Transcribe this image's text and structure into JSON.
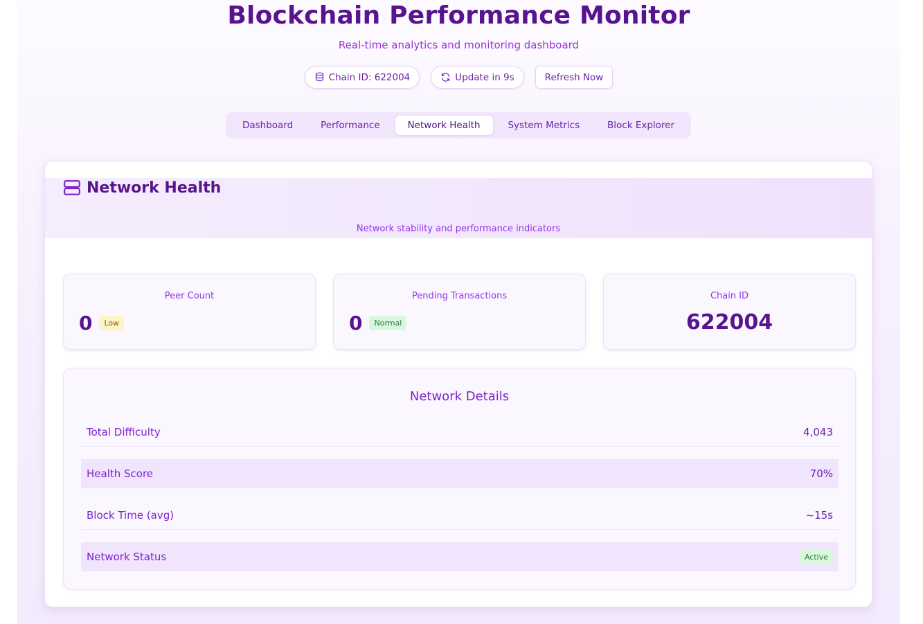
{
  "header": {
    "title": "Blockchain Performance Monitor",
    "subtitle": "Real-time analytics and monitoring dashboard"
  },
  "actions": {
    "chain_id_label": "Chain ID: 622004",
    "update_label": "Update in 9s",
    "refresh_label": "Refresh Now",
    "chain_icon": "database-icon",
    "update_icon": "refresh-icon"
  },
  "tabs": [
    {
      "label": "Dashboard",
      "active": false
    },
    {
      "label": "Performance",
      "active": false
    },
    {
      "label": "Network Health",
      "active": true
    },
    {
      "label": "System Metrics",
      "active": false
    },
    {
      "label": "Block Explorer",
      "active": false
    }
  ],
  "card": {
    "title": "Network Health",
    "icon": "server-icon",
    "description": "Network stability and performance indicators"
  },
  "stats": {
    "peer_count": {
      "label": "Peer Count",
      "value": "0",
      "badge": "Low"
    },
    "pending_tx": {
      "label": "Pending Transactions",
      "value": "0",
      "badge": "Normal"
    },
    "chain_id": {
      "label": "Chain ID",
      "value": "622004"
    }
  },
  "details": {
    "title": "Network Details",
    "rows": [
      {
        "label": "Total Difficulty",
        "value": "4,043"
      },
      {
        "label": "Health Score",
        "value": "70%"
      },
      {
        "label": "Block Time (avg)",
        "value": "~15s"
      },
      {
        "label": "Network Status",
        "value": "Active"
      }
    ]
  },
  "colors": {
    "accent": "#57148e",
    "secondary": "#9333ea",
    "tab_bg": "#f1e6fc",
    "badge_low": "#fdf3c4",
    "badge_ok": "#d9f7df"
  }
}
